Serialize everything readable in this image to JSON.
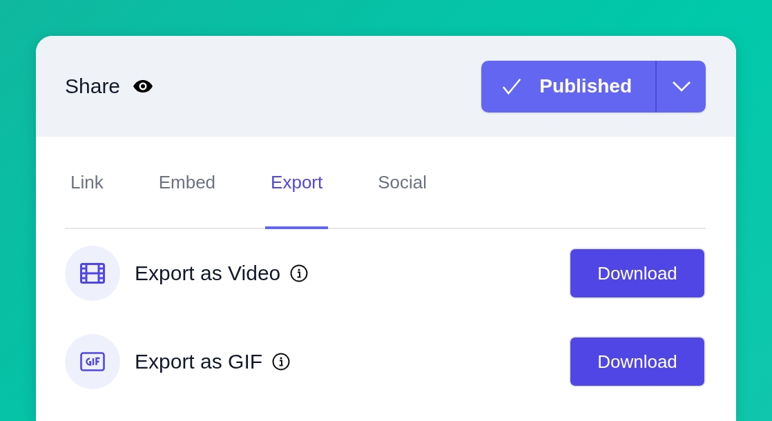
{
  "header": {
    "title": "Share",
    "status_button": {
      "label": "Published"
    }
  },
  "tabs": [
    {
      "label": "Link",
      "selected": false
    },
    {
      "label": "Embed",
      "selected": false
    },
    {
      "label": "Export",
      "selected": true
    },
    {
      "label": "Social",
      "selected": false
    }
  ],
  "export_options": [
    {
      "kind": "video",
      "label": "Export as Video",
      "button": "Download"
    },
    {
      "kind": "gif",
      "label": "Export as GIF",
      "button": "Download"
    }
  ]
}
